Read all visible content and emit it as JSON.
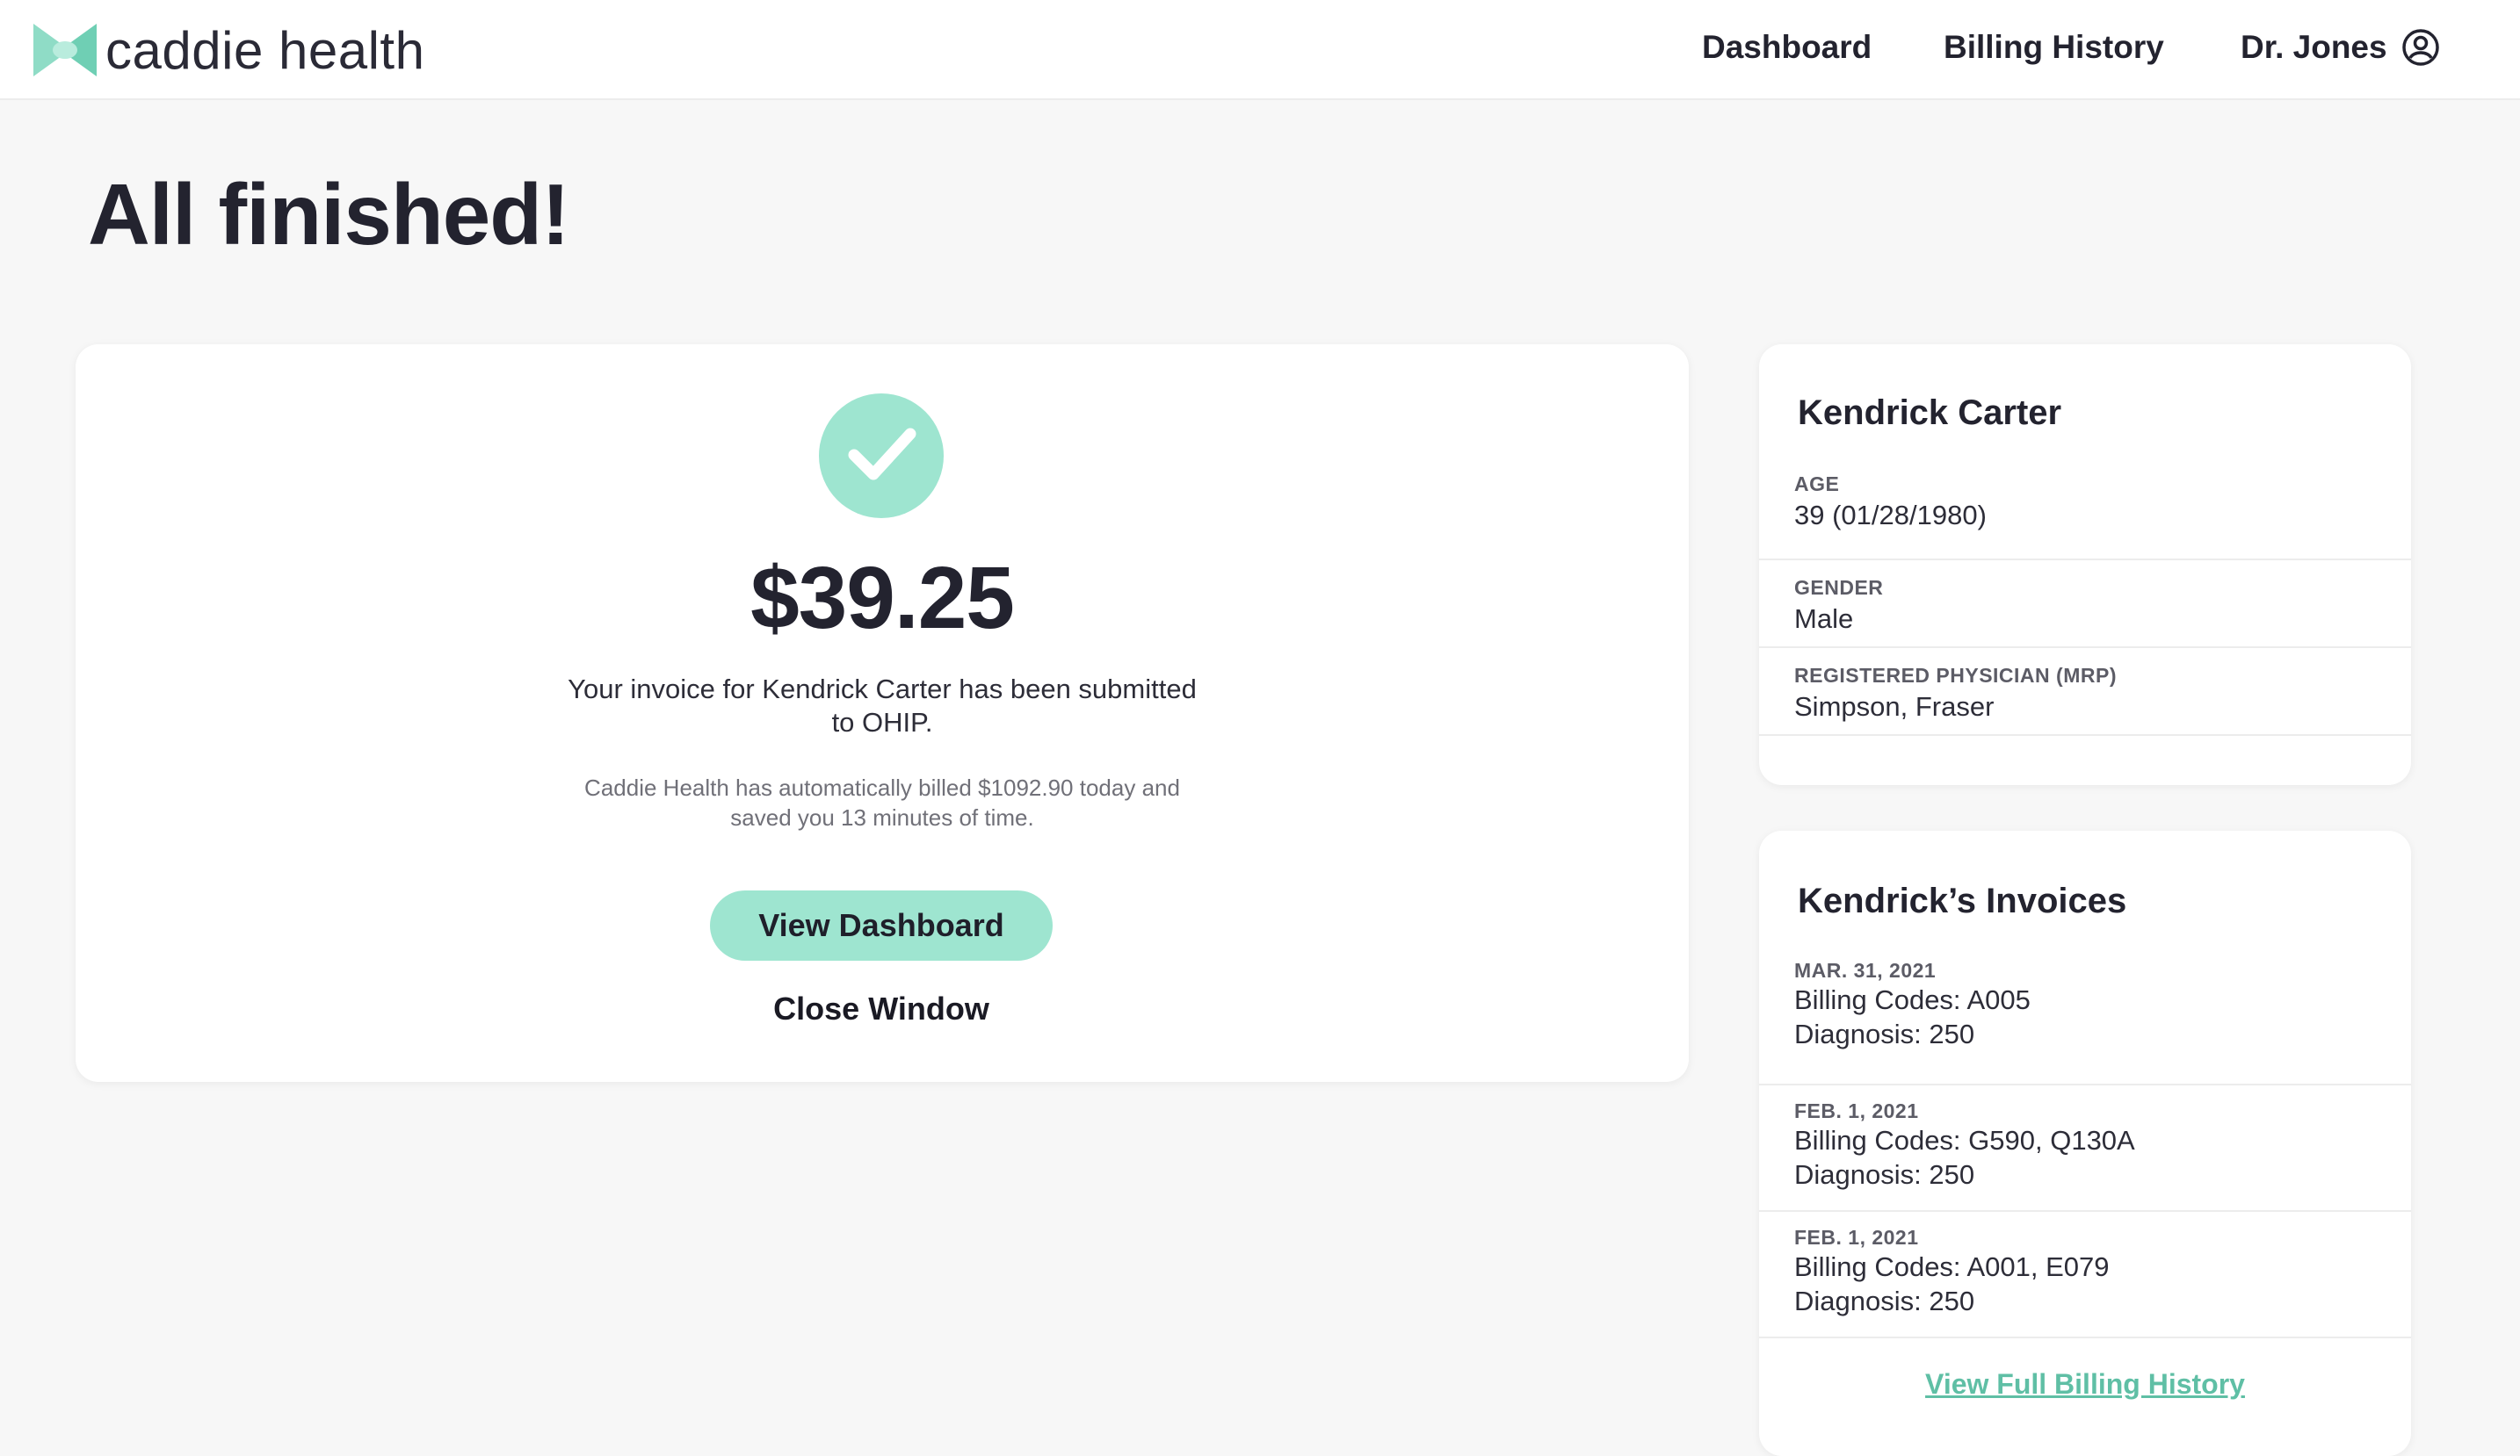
{
  "brand": {
    "name": "caddie health",
    "accent": "#9ee5d0",
    "link_color": "#5fbfa5"
  },
  "nav": {
    "dashboard": "Dashboard",
    "billing_history": "Billing History",
    "user": "Dr. Jones"
  },
  "page_title": "All finished!",
  "summary": {
    "amount": "$39.25",
    "message": "Your invoice for Kendrick Carter has been submitted to OHIP.",
    "savings": "Caddie Health has automatically billed $1092.90 today and saved you 13 minutes of time.",
    "view_dashboard": "View Dashboard",
    "close_window": "Close Window"
  },
  "patient": {
    "name": "Kendrick Carter",
    "fields": [
      {
        "label": "AGE",
        "value": "39 (01/28/1980)"
      },
      {
        "label": "GENDER",
        "value": "Male"
      },
      {
        "label": "REGISTERED PHYSICIAN (MRP)",
        "value": "Simpson, Fraser"
      }
    ]
  },
  "invoices": {
    "title": "Kendrick’s Invoices",
    "items": [
      {
        "date": "MAR. 31, 2021",
        "codes": "Billing Codes: A005",
        "diagnosis": "Diagnosis: 250"
      },
      {
        "date": "FEB. 1, 2021",
        "codes": "Billing Codes: G590, Q130A",
        "diagnosis": "Diagnosis: 250"
      },
      {
        "date": "FEB. 1, 2021",
        "codes": "Billing Codes: A001, E079",
        "diagnosis": "Diagnosis: 250"
      }
    ],
    "full_history_link": "View Full Billing History"
  },
  "icons": {
    "logo": "bowtie-logo-icon",
    "user": "user-circle-icon",
    "success": "checkmark-icon"
  }
}
